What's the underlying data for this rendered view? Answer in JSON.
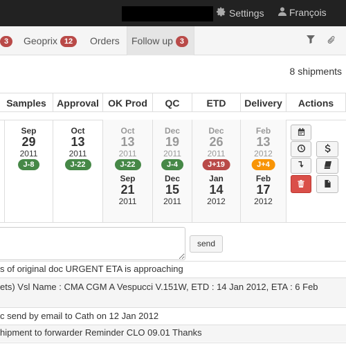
{
  "topbar": {
    "settings_label": "Settings",
    "user_name": "François"
  },
  "tabs": [
    {
      "badge": "3"
    },
    {
      "label": "Geoprix",
      "badge": "12"
    },
    {
      "label": "Orders"
    },
    {
      "label": "Follow up",
      "badge": "3",
      "active": true
    }
  ],
  "toolbar": {
    "filter_icon": "filter-icon",
    "clip_icon": "paperclip-icon"
  },
  "shipment_count": "8 shipments",
  "columns": [
    "Samples",
    "Approval",
    "OK Prod",
    "QC",
    "ETD",
    "Delivery",
    "Actions"
  ],
  "row": {
    "samples": {
      "month": "Sep",
      "day": "29",
      "year": "2011",
      "tag": "J-8",
      "tag_color": "green"
    },
    "approval": {
      "month": "Oct",
      "day": "13",
      "year": "2011",
      "tag": "J-22",
      "tag_color": "green"
    },
    "okprod": {
      "planned": {
        "month": "Oct",
        "day": "13",
        "year": "2011"
      },
      "tag": "J-22",
      "tag_color": "green",
      "actual": {
        "month": "Sep",
        "day": "21",
        "year": "2011"
      }
    },
    "qc": {
      "planned": {
        "month": "Dec",
        "day": "19",
        "year": "2011"
      },
      "tag": "J-4",
      "tag_color": "green",
      "actual": {
        "month": "Dec",
        "day": "15",
        "year": "2011"
      }
    },
    "etd": {
      "planned": {
        "month": "Dec",
        "day": "26",
        "year": "2011"
      },
      "tag": "J+19",
      "tag_color": "red",
      "actual": {
        "month": "Jan",
        "day": "14",
        "year": "2012"
      }
    },
    "delivery": {
      "planned": {
        "month": "Feb",
        "day": "13",
        "year": "2012"
      },
      "tag": "J+4",
      "tag_color": "orange",
      "actual": {
        "month": "Feb",
        "day": "17",
        "year": "2012"
      }
    }
  },
  "comment": {
    "placeholder": "",
    "send_label": "send"
  },
  "notes": [
    "s of original doc URGENT ETA is approaching",
    "ets) Vsl Name : CMA CGM A Vespucci V.151W, ETD : 14 Jan 2012, ETA : 6 Feb",
    "c send by email to Cath on 12 Jan 2012",
    "hipment to forwarder Reminder CLO 09.01 Thanks"
  ],
  "colors": {
    "green": "#468847",
    "red": "#b94a48",
    "orange": "#f89406",
    "topbar": "#222222"
  }
}
